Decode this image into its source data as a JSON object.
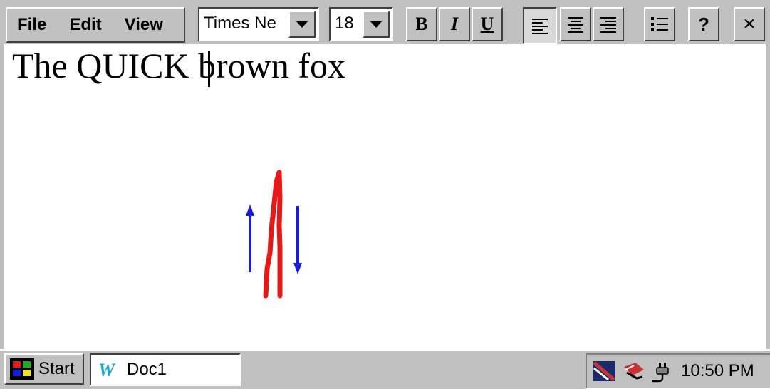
{
  "menu": {
    "file": "File",
    "edit": "Edit",
    "view": "View"
  },
  "format": {
    "font_name": "Times Ne",
    "font_size": "18"
  },
  "toolbar_buttons": {
    "bold": "B",
    "italic": "I",
    "underline": "U",
    "help": "?",
    "close": "×",
    "align_left_pressed": true
  },
  "document": {
    "text": "The QUICK brown fox",
    "gesture_colors": {
      "arrows": "#1a1adb",
      "stroke": "#e41a1a"
    }
  },
  "taskbar": {
    "start_label": "Start",
    "doc_label": "Doc1",
    "clock": "10:50 PM"
  }
}
